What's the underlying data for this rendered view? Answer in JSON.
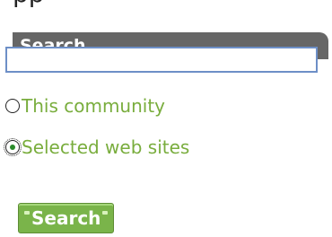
{
  "search_widget": {
    "header_label": "Search",
    "input_value": "",
    "option_this_community": "This community",
    "option_selected_sites": "Selected web sites",
    "selected_option": "Selected web sites",
    "button_label": "Search"
  },
  "colors": {
    "header_bg": "#666666",
    "option_text": "#79ad3d",
    "button_bg": "#7ab44a",
    "input_border": "#6d8fc7"
  }
}
